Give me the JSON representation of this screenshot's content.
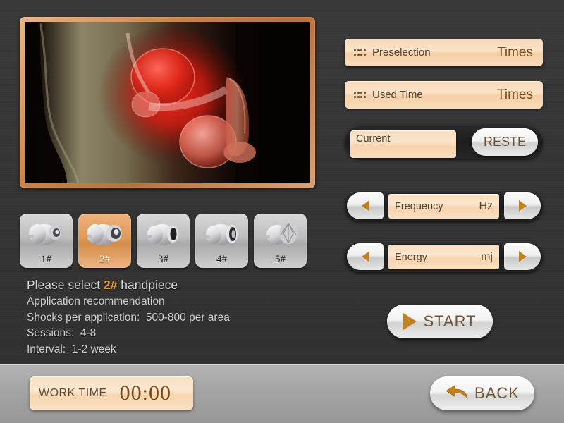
{
  "colors": {
    "background": "#343434",
    "panel_field": "#fbe3c8",
    "accent_orange": "#ef9a20",
    "frame_border": "#c9854e",
    "text_light": "#d2d2d2",
    "value_text": "#7a4d1b",
    "bottom_bar": "#a9a9a9"
  },
  "image_panel": {
    "alt": "anatomical rendering of pelvis with highlighted red treatment area"
  },
  "handpieces": [
    {
      "label": "1#",
      "icon": "handpiece-icon",
      "selected": false
    },
    {
      "label": "2#",
      "icon": "handpiece-icon",
      "selected": true
    },
    {
      "label": "3#",
      "icon": "handpiece-icon",
      "selected": false
    },
    {
      "label": "4#",
      "icon": "handpiece-icon",
      "selected": false
    },
    {
      "label": "5#",
      "icon": "handpiece-icon",
      "selected": false
    }
  ],
  "info": {
    "prompt_prefix": "Please select ",
    "prompt_highlight": "2#",
    "prompt_suffix": " handpiece",
    "heading": "Application recommendation",
    "shocks_label": "Shocks per application:",
    "shocks_value": "500-800 per area",
    "sessions_label": "Sessions:",
    "sessions_value": "4-8",
    "interval_label": "Interval:",
    "interval_value": "1-2 week"
  },
  "counters": [
    {
      "icon": "dot-grid-icon",
      "label": "Preselection",
      "value": "",
      "unit": "Times"
    },
    {
      "icon": "dot-grid-icon",
      "label": "Used Time",
      "value": "",
      "unit": "Times"
    }
  ],
  "current": {
    "label": "Current",
    "value": "",
    "reset_label": "RESTE"
  },
  "steppers": [
    {
      "label": "Frequency",
      "value": "",
      "unit": "Hz",
      "dec_icon": "triangle-left-icon",
      "inc_icon": "triangle-right-icon"
    },
    {
      "label": "Energy",
      "value": "",
      "unit": "mj",
      "dec_icon": "triangle-left-icon",
      "inc_icon": "triangle-right-icon"
    }
  ],
  "start": {
    "label": "START",
    "icon": "play-triangle-icon"
  },
  "worktime": {
    "label": "WORK TIME",
    "value": "00:00"
  },
  "back": {
    "label": "BACK",
    "icon": "arrow-left-icon"
  }
}
